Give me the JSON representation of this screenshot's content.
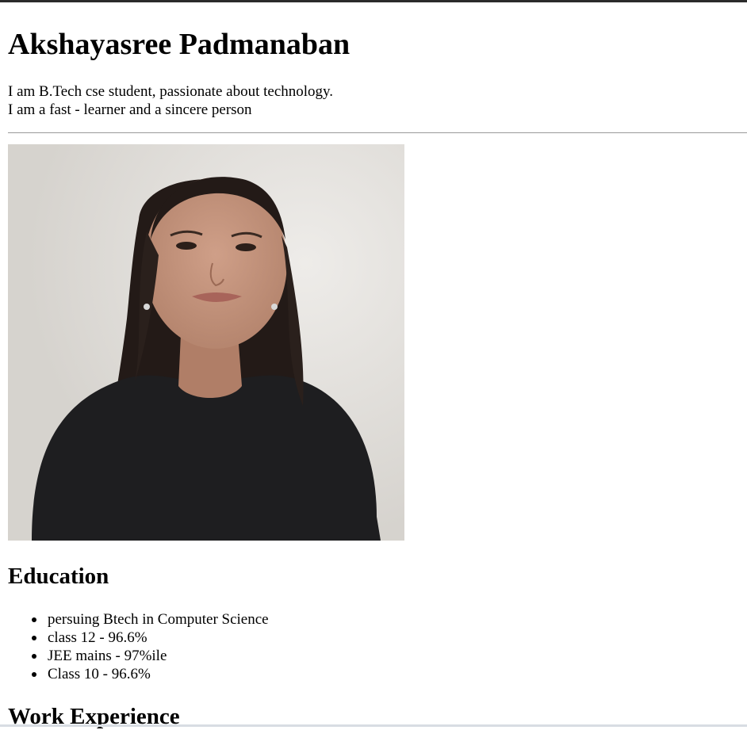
{
  "profile": {
    "name": "Akshayasree Padmanaban",
    "intro_line1": "I am B.Tech cse student, passionate about technology.",
    "intro_line2": "I am a fast - learner and a sincere person",
    "photo_alt": "profile photo"
  },
  "education": {
    "heading": "Education",
    "items": [
      "persuing Btech in Computer Science",
      "class 12 - 96.6%",
      "JEE mains - 97%ile",
      "Class 10 - 96.6%"
    ]
  },
  "work": {
    "heading": "Work Experience"
  },
  "colors": {
    "top_bar": "#2b2b2b",
    "divider": "#9a9a9a",
    "shirt": "#1e1e20",
    "hair": "#231a17",
    "skin": "#c2957e"
  }
}
